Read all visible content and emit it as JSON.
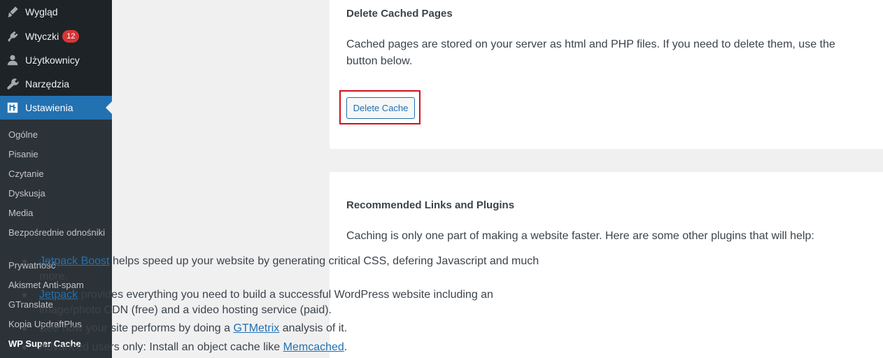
{
  "sidebar": {
    "items": [
      {
        "label": "Wygląd",
        "icon": "paintbrush-icon"
      },
      {
        "label": "Wtyczki",
        "icon": "plugin-icon",
        "badge": "12"
      },
      {
        "label": "Użytkownicy",
        "icon": "users-icon"
      },
      {
        "label": "Narzędzia",
        "icon": "wrench-icon"
      },
      {
        "label": "Ustawienia",
        "icon": "settings-icon",
        "active": true
      }
    ],
    "submenu": [
      "Ogólne",
      "Pisanie",
      "Czytanie",
      "Dyskusja",
      "Media",
      "Bezpośrednie odnośniki",
      "Prywatność",
      "Akismet Anti-spam",
      "GTranslate",
      "Kopia UpdraftPlus",
      "WP Super Cache"
    ],
    "current_submenu": "WP Super Cache"
  },
  "delete_section": {
    "heading": "Delete Cached Pages",
    "description": "Cached pages are stored on your server as html and PHP files. If you need to delete them, use the button below.",
    "button_label": "Delete Cache"
  },
  "recommended": {
    "heading": "Recommended Links and Plugins",
    "intro": "Caching is only one part of making a website faster. Here are some other plugins that will help:",
    "items": [
      {
        "pre": "",
        "link": "Jetpack Boost",
        "post": " helps speed up your website by generating critical CSS, defering Javascript and much more."
      },
      {
        "pre": "",
        "link": "Jetpack",
        "post": " provides everything you need to build a successful WordPress website including an image/photo CDN (free) and a video hosting service (paid)."
      },
      {
        "pre": "See how your site performs by doing a ",
        "link": "GTMetrix",
        "post": " analysis of it."
      },
      {
        "pre": "Advanced users only: Install an object cache like ",
        "link": "Memcached",
        "post": "."
      }
    ]
  },
  "colors": {
    "sidebar_bg": "#1d2327",
    "submenu_bg": "#2c3338",
    "accent": "#2271b1",
    "badge": "#d63638",
    "highlight_box": "#d0111d"
  }
}
